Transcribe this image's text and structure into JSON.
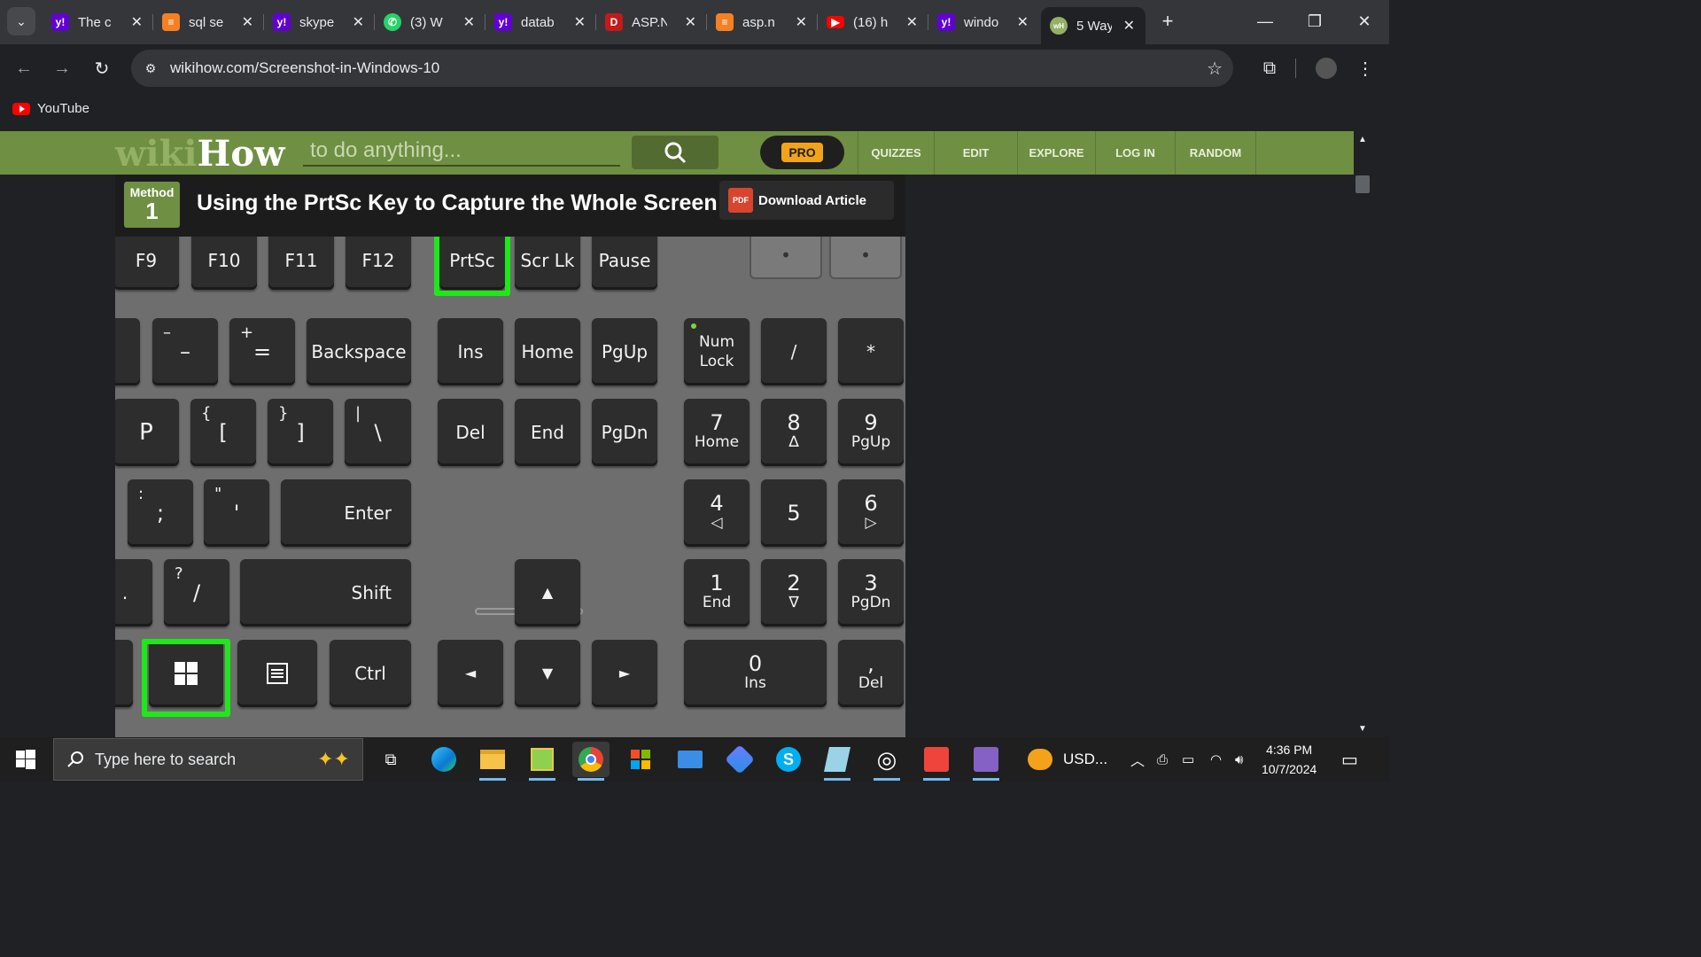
{
  "browser": {
    "tabs": [
      {
        "label": "The c",
        "favicon": "yahoo-icon",
        "color": "#6001d2",
        "glyph": "y!"
      },
      {
        "label": "sql se",
        "favicon": "stackoverflow-icon",
        "color": "#f48024",
        "glyph": "≡"
      },
      {
        "label": "skype",
        "favicon": "yahoo-icon",
        "color": "#6001d2",
        "glyph": "y!"
      },
      {
        "label": "(3) W",
        "favicon": "whatsapp-icon",
        "color": "#25d366",
        "glyph": "✆"
      },
      {
        "label": "datab",
        "favicon": "yahoo-icon",
        "color": "#6001d2",
        "glyph": "y!"
      },
      {
        "label": "ASP.N",
        "favicon": "aspnet-icon",
        "color": "#c41a1a",
        "glyph": "D"
      },
      {
        "label": "asp.n",
        "favicon": "stackoverflow-icon",
        "color": "#f48024",
        "glyph": "≡"
      },
      {
        "label": "(16) h",
        "favicon": "youtube-icon",
        "color": "#ff0000",
        "glyph": "▶"
      },
      {
        "label": "windo",
        "favicon": "yahoo-icon",
        "color": "#6001d2",
        "glyph": "y!"
      },
      {
        "label": "5 Way",
        "favicon": "wikihow-icon",
        "color": "#93b064",
        "glyph": "wH"
      }
    ],
    "url": "wikihow.com/Screenshot-in-Windows-10",
    "bookmark": "YouTube"
  },
  "wikihow": {
    "logo_wiki": "wiki",
    "logo_how": "How",
    "search_placeholder": "to do anything...",
    "pro": "PRO",
    "nav": [
      "QUIZZES",
      "EDIT",
      "EXPLORE",
      "LOG IN",
      "RANDOM"
    ],
    "method_label": "Method",
    "method_number": "1",
    "method_title": "Using the PrtSc Key to Capture the Whole Screen",
    "download": "Download Article",
    "pdf": "PDF"
  },
  "keyboard": {
    "fn": [
      "F9",
      "F10",
      "F11",
      "F12",
      "PrtSc",
      "Scr Lk",
      "Pause"
    ],
    "row2": {
      "minus_top": "–",
      "minus": "–",
      "equals_top": "+",
      "equals": "=",
      "backspace": "Backspace"
    },
    "nav1": [
      "Ins",
      "Home",
      "PgUp"
    ],
    "nav2": [
      "Del",
      "End",
      "PgDn"
    ],
    "numlock": [
      "Num",
      "Lock"
    ],
    "slash": "/",
    "star": "*",
    "row3": {
      "p": "P",
      "lbr_top": "{",
      "lbr": "[",
      "rbr_top": "}",
      "rbr": "]",
      "bs_top": "|",
      "bs": "\\"
    },
    "row4": {
      "semi_top": ":",
      "semi": ";",
      "quote_top": "\"",
      "quote": "'",
      "enter": "Enter"
    },
    "row5": {
      "dot": ".",
      "q_top": "?",
      "q": "/",
      "shift": "Shift"
    },
    "ctrl": "Ctrl",
    "arrows": {
      "up": "▲",
      "left": "◄",
      "down": "▼",
      "right": "►"
    },
    "numpad": {
      "n7": "7",
      "n7s": "Home",
      "n8": "8",
      "n8s": "∆",
      "n9": "9",
      "n9s": "PgUp",
      "n4": "4",
      "n4s": "◁",
      "n5": "5",
      "n6": "6",
      "n6s": "▷",
      "n1": "1",
      "n1s": "End",
      "n2": "2",
      "n2s": "∇",
      "n3": "3",
      "n3s": "PgDn",
      "n0": "0",
      "n0s": "Ins",
      "ndot": ",",
      "ndots": "Del"
    }
  },
  "taskbar": {
    "search_placeholder": "Type here to search",
    "weather": "USD...",
    "time": "4:36 PM",
    "date": "10/7/2024"
  }
}
